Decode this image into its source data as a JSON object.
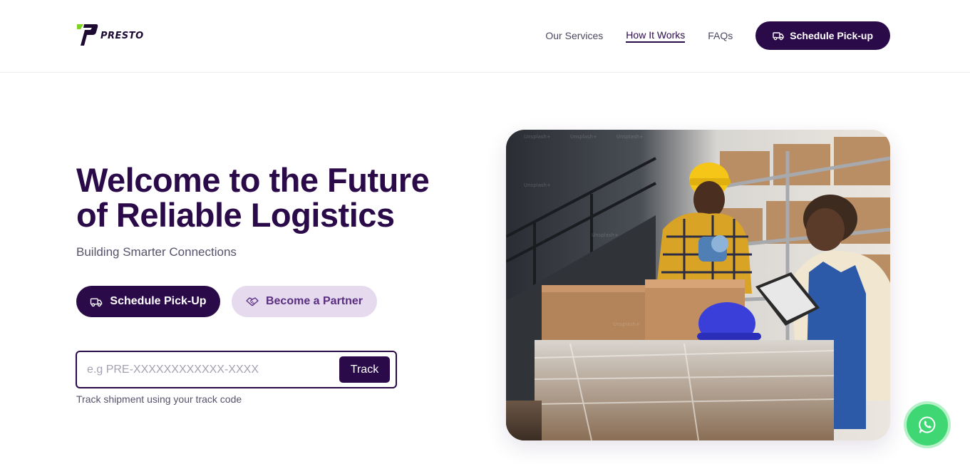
{
  "brand": {
    "name": "PRESTO",
    "accent_color": "#2b0a4a",
    "logo_accent": "#7ed321"
  },
  "nav": {
    "links": [
      "Our Services",
      "How It Works",
      "FAQs"
    ],
    "active": "How It Works",
    "cta_label": "Schedule Pick-up",
    "cta_icon": "truck-icon"
  },
  "hero": {
    "title_line1": "Welcome to the Future",
    "title_line2": "of Reliable Logistics",
    "subtitle": "Building Smarter Connections",
    "primary_button": {
      "label": "Schedule Pick-Up",
      "icon": "truck-icon"
    },
    "secondary_button": {
      "label": "Become a Partner",
      "icon": "handshake-icon"
    },
    "image_alt": "Warehouse workers packing boxes",
    "watermark": "Unsplash+"
  },
  "tracking": {
    "placeholder": "e.g PRE-XXXXXXXXXXXX-XXXX",
    "value": "",
    "button_label": "Track",
    "hint": "Track shipment using your track code"
  },
  "floating": {
    "icon": "whatsapp-icon",
    "color": "#3fd773"
  }
}
